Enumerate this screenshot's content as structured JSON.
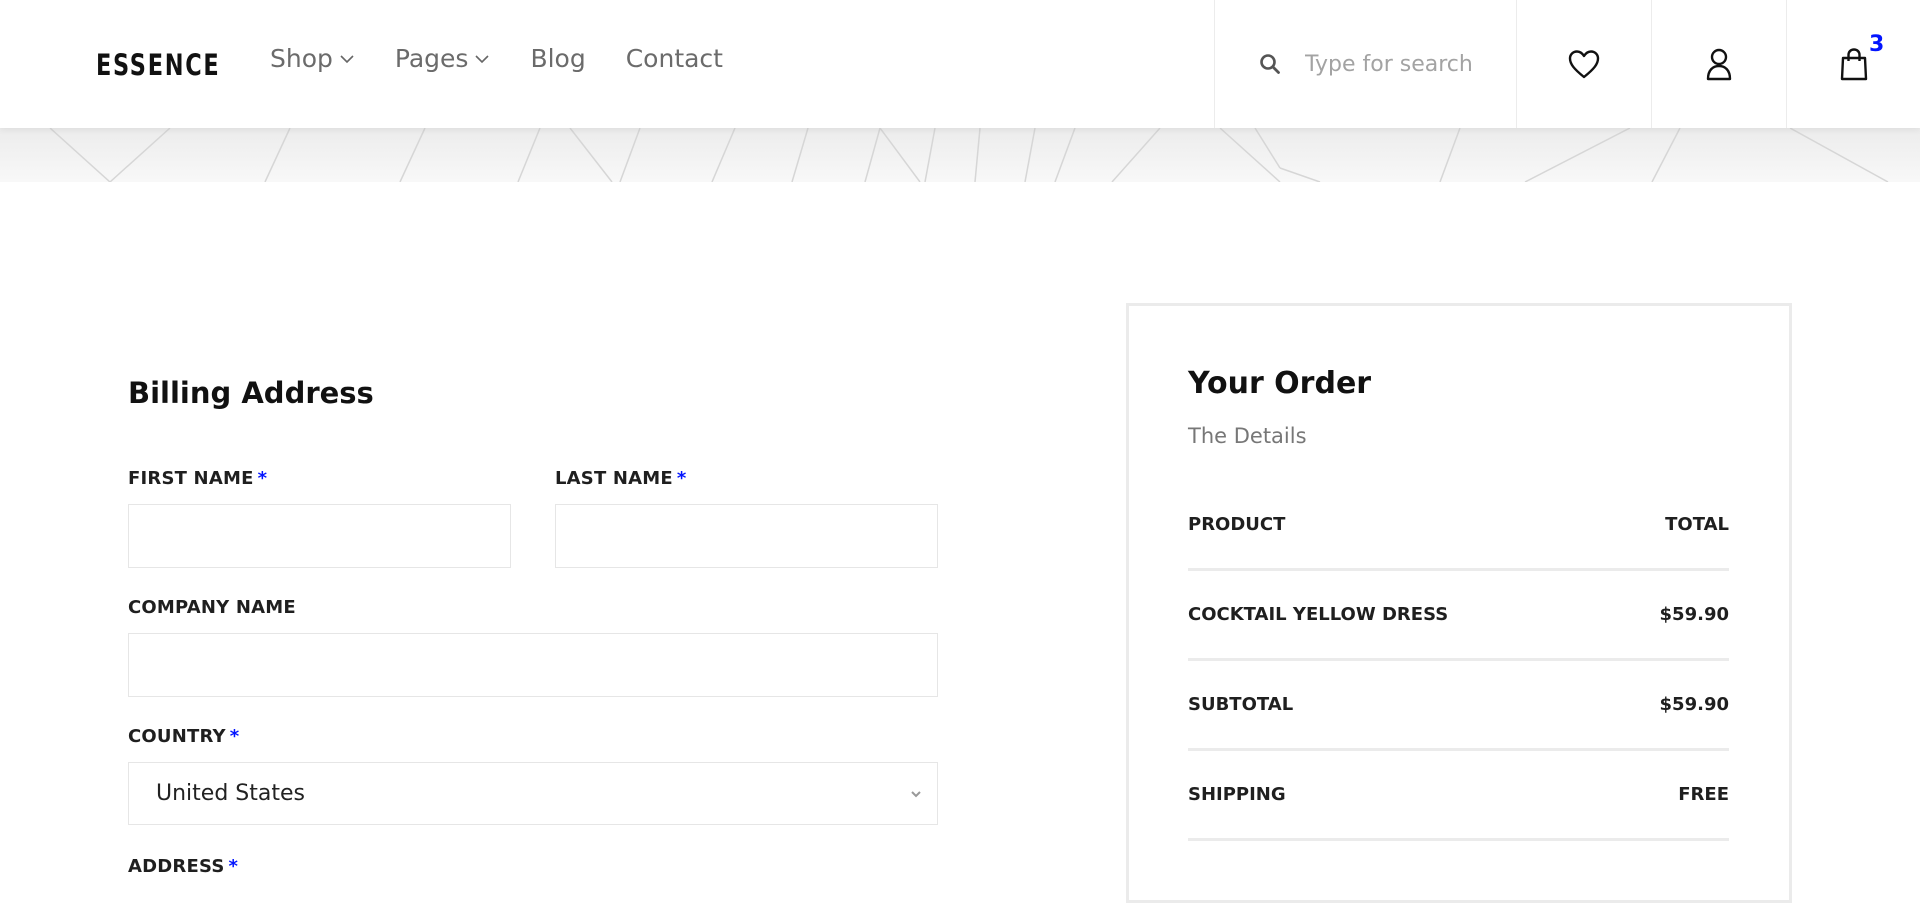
{
  "header": {
    "logo": "ESSENCE",
    "nav": [
      {
        "label": "Shop",
        "has_dropdown": true
      },
      {
        "label": "Pages",
        "has_dropdown": true
      },
      {
        "label": "Blog",
        "has_dropdown": false
      },
      {
        "label": "Contact",
        "has_dropdown": false
      }
    ],
    "search": {
      "placeholder": "Type for search",
      "icon": "search-icon"
    },
    "icons": {
      "favorites": "heart-icon",
      "account": "user-icon",
      "cart": "shopping-bag-icon"
    },
    "cart_count": "3"
  },
  "billing": {
    "title": "Billing Address",
    "required_mark": "*",
    "first_name": {
      "label": "FIRST NAME",
      "value": ""
    },
    "last_name": {
      "label": "LAST NAME",
      "value": ""
    },
    "company_name": {
      "label": "COMPANY NAME",
      "value": ""
    },
    "country": {
      "label": "COUNTRY",
      "value": "United States"
    },
    "address": {
      "label": "ADDRESS"
    }
  },
  "order": {
    "title": "Your Order",
    "subtitle": "The Details",
    "rows": [
      {
        "label": "PRODUCT",
        "value": "TOTAL"
      },
      {
        "label": "COCKTAIL YELLOW DRESS",
        "value": "$59.90"
      },
      {
        "label": "SUBTOTAL",
        "value": "$59.90"
      },
      {
        "label": "SHIPPING",
        "value": "FREE"
      }
    ]
  },
  "colors": {
    "accent": "#0315ff",
    "border": "#ebebeb",
    "nav_text": "#6b6b6b"
  }
}
